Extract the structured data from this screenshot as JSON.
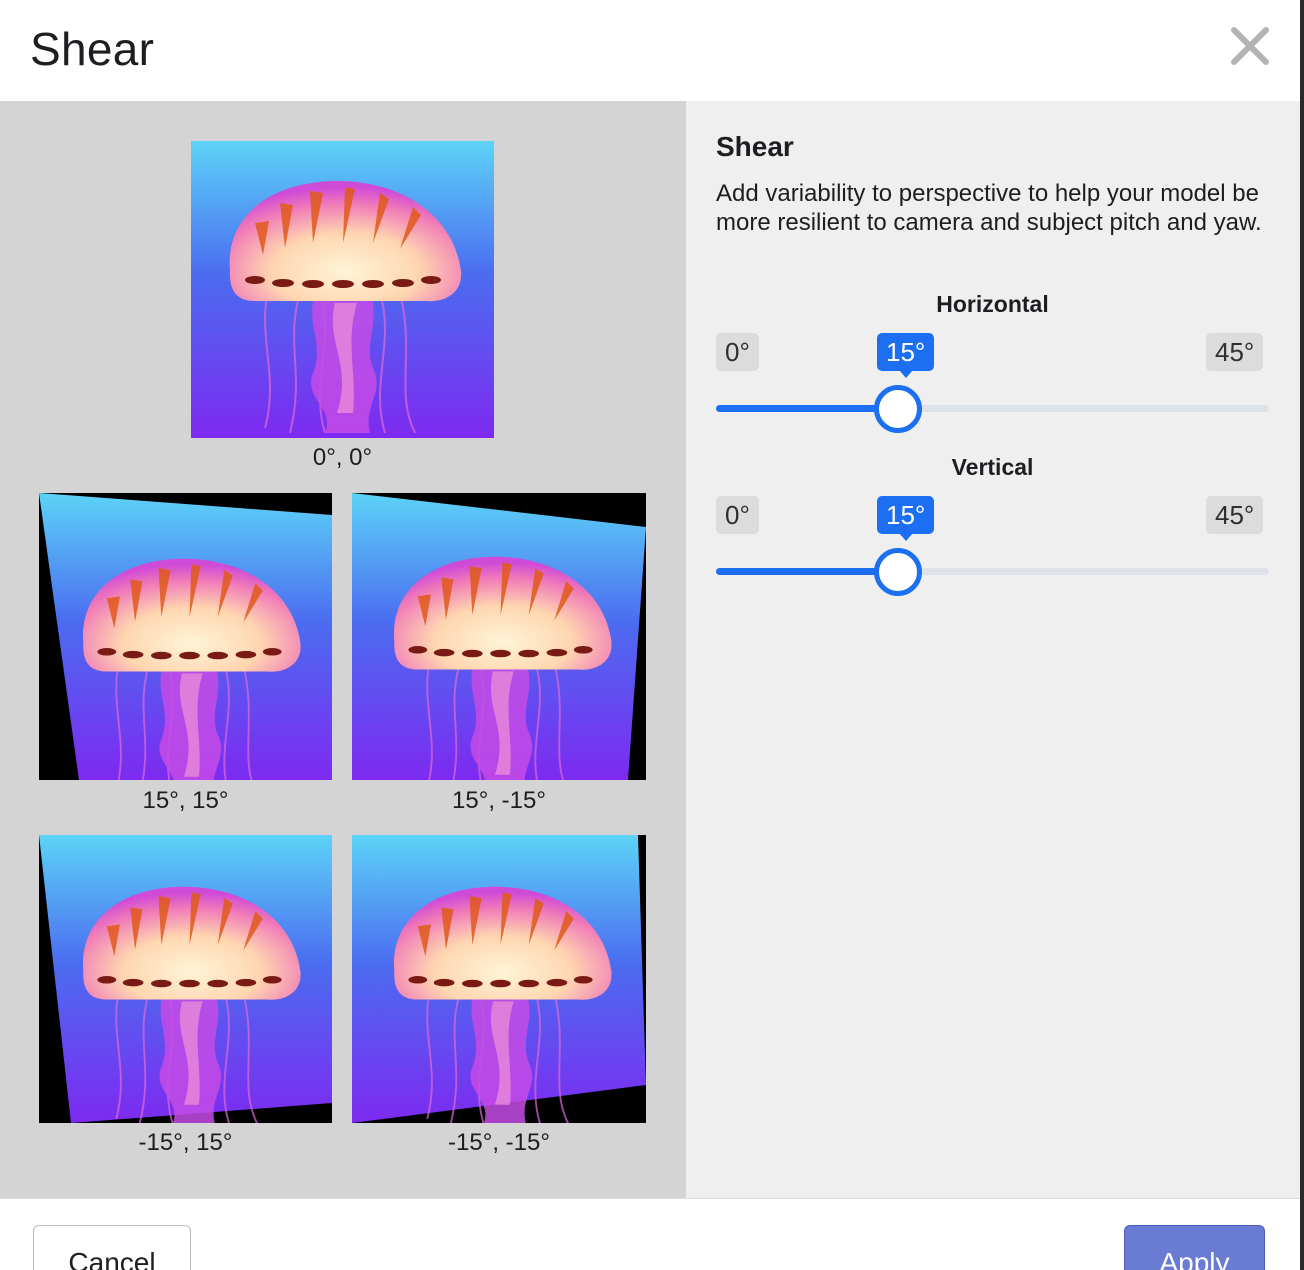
{
  "dialog": {
    "title": "Shear"
  },
  "preview": {
    "original_caption": "0°, 0°",
    "variants": [
      {
        "caption": "15°, 15°"
      },
      {
        "caption": "15°, -15°"
      },
      {
        "caption": "-15°, 15°"
      },
      {
        "caption": "-15°, -15°"
      }
    ]
  },
  "settings": {
    "heading": "Shear",
    "description": "Add variability to perspective to help your model be more resilient to camera and subject pitch and yaw.",
    "horizontal": {
      "label": "Horizontal",
      "min": "0°",
      "current": "15°",
      "max": "45°",
      "fraction": 0.33
    },
    "vertical": {
      "label": "Vertical",
      "min": "0°",
      "current": "15°",
      "max": "45°",
      "fraction": 0.33
    }
  },
  "footer": {
    "cancel_label": "Cancel",
    "apply_label": "Apply"
  },
  "colors": {
    "accent": "#1d6ff2",
    "apply": "#6a7bd3"
  }
}
